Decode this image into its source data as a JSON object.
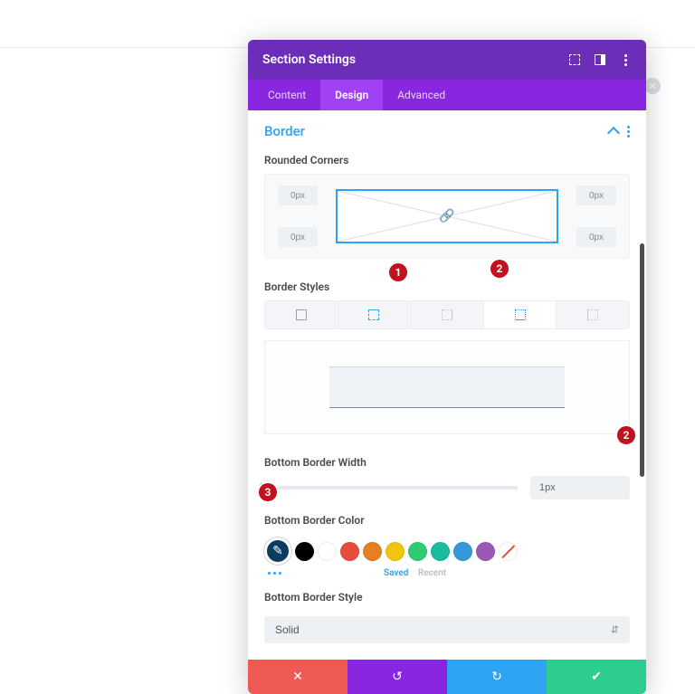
{
  "header": {
    "title": "Section Settings"
  },
  "tabs": {
    "content": "Content",
    "design": "Design",
    "advanced": "Advanced"
  },
  "section": {
    "title": "Border"
  },
  "rounded_corners": {
    "label": "Rounded Corners",
    "tl": "0px",
    "tr": "0px",
    "bl": "0px",
    "br": "0px"
  },
  "border_styles": {
    "label": "Border Styles"
  },
  "bottom_width": {
    "label": "Bottom Border Width",
    "value": "1px"
  },
  "bottom_color": {
    "label": "Bottom Border Color",
    "saved": "Saved",
    "recent": "Recent",
    "swatches": [
      "#000000",
      "#ffffff",
      "#e74c3c",
      "#e67e22",
      "#f1c40f",
      "#2ecc71",
      "#1abc9c",
      "#3498db",
      "#9b59b6"
    ]
  },
  "bottom_style": {
    "label": "Bottom Border Style",
    "value": "Solid"
  },
  "annotations": {
    "a1": "1",
    "a2": "2",
    "a2b": "2",
    "a3": "3"
  }
}
